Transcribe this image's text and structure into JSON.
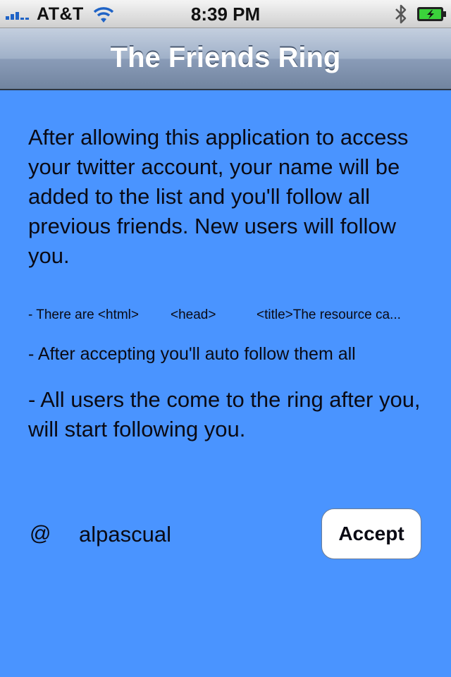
{
  "status_bar": {
    "carrier": "AT&T",
    "time": "8:39 PM",
    "icons": [
      "signal-icon",
      "wifi-icon",
      "bluetooth-icon",
      "battery-icon"
    ],
    "signal_color": "#1f63c6",
    "battery_color": "#3bd23b"
  },
  "nav": {
    "title": "The Friends Ring"
  },
  "content": {
    "intro": "After allowing this application to access your twitter account, your name will be added to the list and you'll follow all previous friends. New users will follow you.",
    "count_line": {
      "part1": "- There are <html>",
      "part2": "<head>",
      "part3": "<title>The resource ca..."
    },
    "follow_line": "- After accepting you'll auto follow them all",
    "after_line": "- All users the come to the ring after you, will start following you."
  },
  "account": {
    "at_sign": "@",
    "username": "alpascual",
    "accept_label": "Accept"
  },
  "colors": {
    "background": "#4a94ff",
    "nav_bar": "#8a9cb8",
    "button_bg": "#ffffff"
  }
}
